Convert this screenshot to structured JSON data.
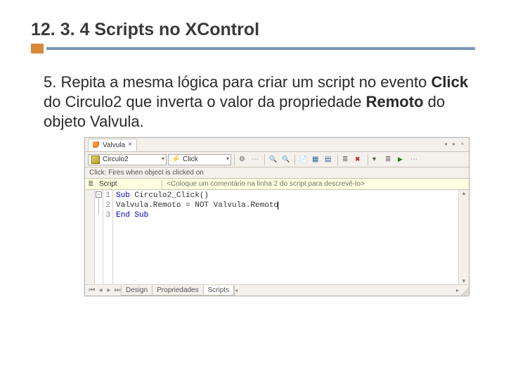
{
  "heading": "12. 3. 4 Scripts no XControl",
  "body": {
    "prefix": "5. Repita a mesma lógica para criar um script no evento ",
    "bold1": "Click",
    "mid1": " do Circulo2 que inverta o valor da propriedade ",
    "bold2": "Remoto",
    "suffix": " do objeto Valvula."
  },
  "editor": {
    "tab_label": "Valvula",
    "object_combo": "Circulo2",
    "event_combo": "Click",
    "desc_line": "Click: Fires when object is clicked on",
    "comment_label": "Script",
    "comment_placeholder": "<Coloque um comentário na linha 2 do script para descrevê-lo>",
    "lines": {
      "l1": "1",
      "l2": "2",
      "l3": "3"
    },
    "code": {
      "l1a": "Sub",
      "l1b": " Circulo2_Click()",
      "l2": "Valvula.Remoto = NOT Valvula.Remoto",
      "l3a": "End",
      "l3b": " ",
      "l3c": "Sub"
    },
    "bottom_tabs": {
      "design": "Design",
      "props": "Propriedades",
      "scripts": "Scripts"
    }
  }
}
